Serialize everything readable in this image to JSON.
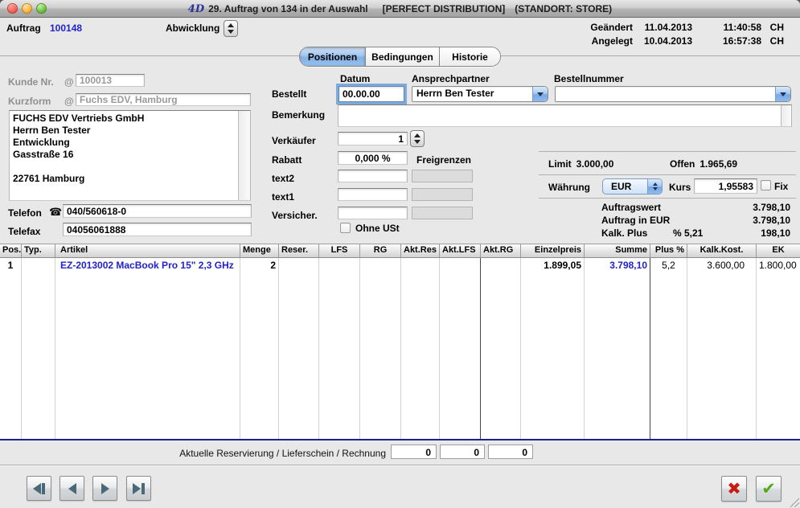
{
  "titlebar": {
    "app_icon": "4D",
    "title": "29. Auftrag von 134 in der Auswahl",
    "environment": "[PERFECT DISTRIBUTION]",
    "standort": "(STANDORT: STORE)"
  },
  "header": {
    "auftrag_label": "Auftrag",
    "auftrag_number": "100148",
    "abwicklung_label": "Abwicklung",
    "geaendert_label": "Geändert",
    "geaendert_date": "11.04.2013",
    "geaendert_time": "11:40:58",
    "geaendert_user": "CH",
    "angelegt_label": "Angelegt",
    "angelegt_date": "10.04.2013",
    "angelegt_time": "16:57:38",
    "angelegt_user": "CH"
  },
  "tabs": [
    {
      "label": "Positionen",
      "active": true
    },
    {
      "label": "Bedingungen",
      "active": false
    },
    {
      "label": "Historie",
      "active": false
    }
  ],
  "customer": {
    "kunde_nr_label": "Kunde Nr.",
    "kunde_nr_at": "@",
    "kunde_nr_value": "100013",
    "kurzform_label": "Kurzform",
    "kurzform_at": "@",
    "kurzform_value": "Fuchs EDV, Hamburg",
    "address_lines": [
      "FUCHS EDV Vertriebs GmbH",
      "Herrn Ben Tester",
      "Entwicklung",
      "Gasstraße 16",
      "",
      "22761 Hamburg"
    ],
    "telefon_label": "Telefon",
    "telefon_value": "040/560618-0",
    "telefax_label": "Telefax",
    "telefax_value": "04056061888"
  },
  "order": {
    "datum_label": "Datum",
    "ansprechpartner_label": "Ansprechpartner",
    "bestellnummer_label": "Bestellnummer",
    "bestellt_label": "Bestellt",
    "bestellt_datum": "00.00.00",
    "ansprechpartner_value": "Herrn Ben Tester",
    "bestellnummer_value": "",
    "bemerkung_label": "Bemerkung",
    "bemerkung_value": "",
    "verkaeufer_label": "Verkäufer",
    "verkaeufer_value": "1",
    "rabatt_label": "Rabatt",
    "rabatt_value": "0,000 %",
    "freigrenzen_label": "Freigrenzen",
    "text2_label": "text2",
    "text1_label": "text1",
    "versicher_label": "Versicher.",
    "ohne_ust_label": "Ohne USt"
  },
  "totals": {
    "limit_label": "Limit",
    "limit_value": "3.000,00",
    "offen_label": "Offen",
    "offen_value": "1.965,69",
    "waehrung_label": "Währung",
    "waehrung_value": "EUR",
    "kurs_label": "Kurs",
    "kurs_value": "1,95583",
    "fix_label": "Fix",
    "auftragswert_label": "Auftragswert",
    "auftragswert_value": "3.798,10",
    "auftrag_in_eur_label": "Auftrag in EUR",
    "auftrag_in_eur_value": "3.798,10",
    "kalk_plus_label": "Kalk. Plus",
    "kalk_plus_percent": "% 5,21",
    "kalk_plus_value": "198,10"
  },
  "table": {
    "columns": [
      "Pos.",
      "Typ.",
      "Artikel",
      "Menge",
      "Reser.",
      "LFS",
      "RG",
      "Akt.Res",
      "Akt.LFS",
      "Akt.RG",
      "Einzelpreis",
      "Summe",
      "Plus %",
      "Kalk.Kost.",
      "EK"
    ],
    "rows": [
      {
        "pos": "1",
        "typ": "",
        "artikel": "EZ-2013002  MacBook Pro 15\" 2,3 GHz",
        "menge": "2",
        "reser": "",
        "lfs": "",
        "rg": "",
        "akt_res": "",
        "akt_lfs": "",
        "akt_rg": "",
        "einzelpreis": "1.899,05",
        "summe": "3.798,10",
        "plus_pct": "5,2",
        "kalk_kost": "3.600,00",
        "ek": "1.800,00"
      }
    ]
  },
  "summary": {
    "label": "Aktuelle Reservierung / Lieferschein / Rechnung",
    "reservierung": "0",
    "lieferschein": "0",
    "rechnung": "0"
  },
  "colors": {
    "accent_blue": "#2222cc",
    "table_bottom_line": "#20208c",
    "tab_selected": "#8cb8e9"
  }
}
